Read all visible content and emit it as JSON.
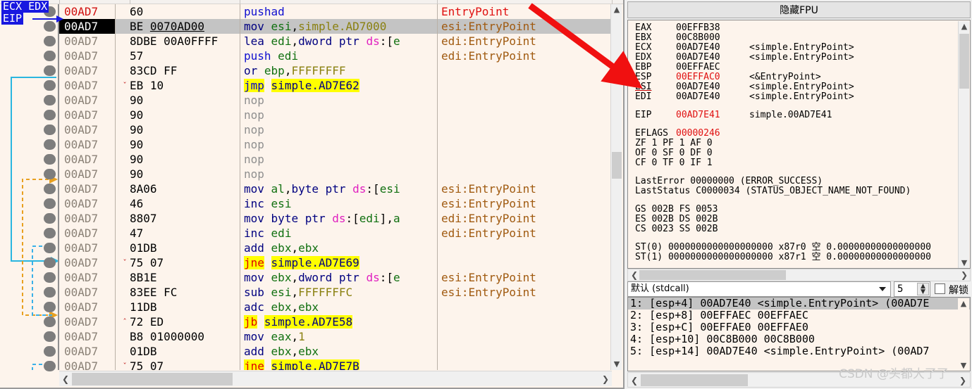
{
  "disassembly": {
    "eip_marker": {
      "line1": "ECX  EDX",
      "line2": "EIP"
    },
    "selected_index": 1,
    "rows": [
      {
        "addr": "00AD7",
        "bytes": "60",
        "jarrow": "",
        "mnem_html": "<span class='k-mn'>pushad</span>",
        "comment": "EntryPoint",
        "cmt_class": "ep0"
      },
      {
        "addr": "00AD7",
        "bytes": "BE <span class='ul'>0070AD00</span>",
        "jarrow": "",
        "mnem_html": "<span class='k-mn2'>mov</span> <span class='k-reg'>esi</span>,<span class='k-addrv'>simple.AD7000</span>",
        "comment": "esi:EntryPoint",
        "cmt_class": ""
      },
      {
        "addr": "00AD7",
        "bytes": "8DBE 00A0FFFF",
        "jarrow": "",
        "mnem_html": "<span class='k-mn2'>lea</span> <span class='k-reg'>edi</span>,<span class='k-mn2'>dword ptr</span> <span class='k-seg'>ds</span>:[<span class='k-reg'>e</span>",
        "comment": "edi:EntryPoint",
        "cmt_class": ""
      },
      {
        "addr": "00AD7",
        "bytes": "57",
        "jarrow": "",
        "mnem_html": "<span class='k-mn'>push</span> <span class='k-reg'>edi</span>",
        "comment": "edi:EntryPoint",
        "cmt_class": ""
      },
      {
        "addr": "00AD7",
        "bytes": "83CD FF",
        "jarrow": "",
        "mnem_html": "<span class='k-mn2'>or</span> <span class='k-reg'>ebp</span>,<span class='k-addrv'>FFFFFFFF</span>",
        "comment": "",
        "cmt_class": ""
      },
      {
        "addr": "00AD7",
        "bytes": "EB 10",
        "jarrow": "v",
        "mnem_html": "<span class='hl-jmp'>jmp</span> <span class='hl-tgt'>simple.AD7E62</span>",
        "comment": "",
        "cmt_class": ""
      },
      {
        "addr": "00AD7",
        "bytes": "90",
        "jarrow": "",
        "mnem_html": "<span class='k-nop'>nop</span>",
        "comment": "",
        "cmt_class": ""
      },
      {
        "addr": "00AD7",
        "bytes": "90",
        "jarrow": "",
        "mnem_html": "<span class='k-nop'>nop</span>",
        "comment": "",
        "cmt_class": ""
      },
      {
        "addr": "00AD7",
        "bytes": "90",
        "jarrow": "",
        "mnem_html": "<span class='k-nop'>nop</span>",
        "comment": "",
        "cmt_class": ""
      },
      {
        "addr": "00AD7",
        "bytes": "90",
        "jarrow": "",
        "mnem_html": "<span class='k-nop'>nop</span>",
        "comment": "",
        "cmt_class": ""
      },
      {
        "addr": "00AD7",
        "bytes": "90",
        "jarrow": "",
        "mnem_html": "<span class='k-nop'>nop</span>",
        "comment": "",
        "cmt_class": ""
      },
      {
        "addr": "00AD7",
        "bytes": "90",
        "jarrow": "",
        "mnem_html": "<span class='k-nop'>nop</span>",
        "comment": "",
        "cmt_class": ""
      },
      {
        "addr": "00AD7",
        "bytes": "8A06",
        "jarrow": "",
        "mnem_html": "<span class='k-mn2'>mov</span> <span class='k-reg'>al</span>,<span class='k-mn2'>byte ptr</span> <span class='k-seg'>ds</span>:[<span class='k-reg'>esi</span>",
        "comment": "esi:EntryPoint",
        "cmt_class": ""
      },
      {
        "addr": "00AD7",
        "bytes": "46",
        "jarrow": "",
        "mnem_html": "<span class='k-mn2'>inc</span> <span class='k-reg'>esi</span>",
        "comment": "esi:EntryPoint",
        "cmt_class": ""
      },
      {
        "addr": "00AD7",
        "bytes": "8807",
        "jarrow": "",
        "mnem_html": "<span class='k-mn2'>mov</span> <span class='k-mn2'>byte ptr</span> <span class='k-seg'>ds</span>:[<span class='k-reg'>edi</span>],<span class='k-reg'>a</span>",
        "comment": "edi:EntryPoint",
        "cmt_class": ""
      },
      {
        "addr": "00AD7",
        "bytes": "47",
        "jarrow": "",
        "mnem_html": "<span class='k-mn2'>inc</span> <span class='k-reg'>edi</span>",
        "comment": "edi:EntryPoint",
        "cmt_class": ""
      },
      {
        "addr": "00AD7",
        "bytes": "01DB",
        "jarrow": "",
        "mnem_html": "<span class='k-mn2'>add</span> <span class='k-reg'>ebx</span>,<span class='k-reg'>ebx</span>",
        "comment": "",
        "cmt_class": ""
      },
      {
        "addr": "00AD7",
        "bytes": "75 07",
        "jarrow": "v",
        "mnem_html": "<span class='hl-jcc'>jne</span> <span class='hl-tgt'>simple.AD7E69</span>",
        "comment": "",
        "cmt_class": ""
      },
      {
        "addr": "00AD7",
        "bytes": "8B1E",
        "jarrow": "",
        "mnem_html": "<span class='k-mn2'>mov</span> <span class='k-reg'>ebx</span>,<span class='k-mn2'>dword ptr</span> <span class='k-seg'>ds</span>:[<span class='k-reg'>e</span>",
        "comment": "esi:EntryPoint",
        "cmt_class": ""
      },
      {
        "addr": "00AD7",
        "bytes": "83EE FC",
        "jarrow": "",
        "mnem_html": "<span class='k-mn2'>sub</span> <span class='k-reg'>esi</span>,<span class='k-addrv'>FFFFFFFC</span>",
        "comment": "esi:EntryPoint",
        "cmt_class": ""
      },
      {
        "addr": "00AD7",
        "bytes": "11DB",
        "jarrow": "",
        "mnem_html": "<span class='k-mn2'>adc</span> <span class='k-reg'>ebx</span>,<span class='k-reg'>ebx</span>",
        "comment": "",
        "cmt_class": ""
      },
      {
        "addr": "00AD7",
        "bytes": "72 ED",
        "jarrow": "^",
        "mnem_html": "<span class='hl-jcc'>jb</span> <span class='hl-tgt'>simple.AD7E58</span>",
        "comment": "",
        "cmt_class": ""
      },
      {
        "addr": "00AD7",
        "bytes": "B8 01000000",
        "jarrow": "",
        "mnem_html": "<span class='k-mn2'>mov</span> <span class='k-reg'>eax</span>,<span class='k-addrv'>1</span>",
        "comment": "",
        "cmt_class": ""
      },
      {
        "addr": "00AD7",
        "bytes": "01DB",
        "jarrow": "",
        "mnem_html": "<span class='k-mn2'>add</span> <span class='k-reg'>ebx</span>,<span class='k-reg'>ebx</span>",
        "comment": "",
        "cmt_class": ""
      },
      {
        "addr": "00AD7",
        "bytes": "75 07",
        "jarrow": "v",
        "mnem_html": "<span class='hl-jcc'>jne</span> <span class='hl-tgt'>simple.AD7E7B</span>",
        "comment": "",
        "cmt_class": ""
      }
    ]
  },
  "registers": {
    "fpu_toggle_label": "隐藏FPU",
    "general": [
      {
        "name": "EAX",
        "value": "00EFFB38",
        "comment": "",
        "red": false,
        "underline": false
      },
      {
        "name": "EBX",
        "value": "00C8B000",
        "comment": "",
        "red": false,
        "underline": false
      },
      {
        "name": "ECX",
        "value": "00AD7E40",
        "comment": "<simple.EntryPoint>",
        "red": false,
        "underline": false
      },
      {
        "name": "EDX",
        "value": "00AD7E40",
        "comment": "<simple.EntryPoint>",
        "red": false,
        "underline": false
      },
      {
        "name": "EBP",
        "value": "00EFFAEC",
        "comment": "",
        "red": false,
        "underline": false
      },
      {
        "name": "ESP",
        "value": "00EFFAC0",
        "comment": "<&EntryPoint>",
        "red": true,
        "underline": false
      },
      {
        "name": "ESI",
        "value": "00AD7E40",
        "comment": "<simple.EntryPoint>",
        "red": false,
        "underline": true
      },
      {
        "name": "EDI",
        "value": "00AD7E40",
        "comment": "<simple.EntryPoint>",
        "red": false,
        "underline": false
      }
    ],
    "eip": {
      "name": "EIP",
      "value": "00AD7E41",
      "comment": "simple.00AD7E41",
      "red": true
    },
    "eflags": {
      "name": "EFLAGS",
      "value": "00000246"
    },
    "flag_rows": [
      "ZF 1  PF 1  AF 0",
      "OF 0  SF 0  DF 0",
      "CF 0  TF 0  IF 1"
    ],
    "last_error": "LastError  00000000 (ERROR_SUCCESS)",
    "last_status": "LastStatus C0000034 (STATUS_OBJECT_NAME_NOT_FOUND)",
    "segments": [
      "GS 002B  FS 0053",
      "ES 002B  DS 002B",
      "CS 0023  SS 002B"
    ],
    "fpu_rows": [
      "ST(0) 0000000000000000000 x87r0 空 0.00000000000000000",
      "ST(1) 0000000000000000000 x87r1 空 0.00000000000000000"
    ]
  },
  "stack": {
    "calling_convention": "默认 (stdcall)",
    "arg_count": "5",
    "lock_label": "解锁",
    "lock_checked": false,
    "rows": [
      {
        "text": "1: [esp+4]  00AD7E40  <simple.EntryPoint>  (00AD7E",
        "selected": true
      },
      {
        "text": "2: [esp+8]  00EFFAEC  00EFFAEC",
        "selected": false
      },
      {
        "text": "3: [esp+C]  00EFFAE0  00EFFAE0",
        "selected": false
      },
      {
        "text": "4: [esp+10] 00C8B000  00C8B000",
        "selected": false
      },
      {
        "text": "5: [esp+14] 00AD7E40  <simple.EntryPoint>  (00AD7",
        "selected": false
      }
    ]
  },
  "annotation": {
    "arrow_color": "#f01010",
    "arrow_target": "ESP register"
  },
  "watermark": {
    "text": "CSDN @头都大了了"
  },
  "colors": {
    "panel_bg": "#fdf4ec",
    "selection": "#c4c4c4",
    "highlight_yellow": "#ffff00",
    "eip_blue": "#1818e0",
    "red": "#e01010"
  }
}
